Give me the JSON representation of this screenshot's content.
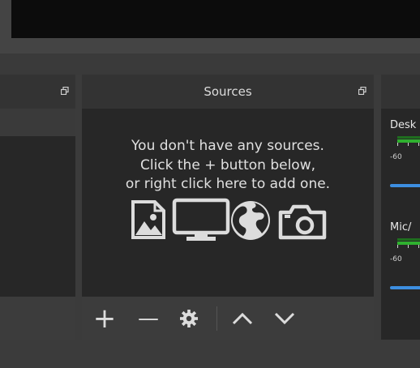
{
  "docks": {
    "sources": {
      "title": "Sources",
      "empty_message": [
        "You don't have any sources.",
        "Click the + button below,",
        "or right click here to add one."
      ],
      "icons": [
        "image-icon",
        "monitor-icon",
        "globe-icon",
        "camera-icon"
      ]
    },
    "mixer": {
      "channels": [
        {
          "label": "Desk",
          "db_label": "-60"
        },
        {
          "label": "Mic/",
          "db_label": "-60"
        }
      ]
    }
  },
  "toolbar": {
    "add_glyph": "+",
    "remove_glyph": "—"
  },
  "colors": {
    "meter_green": "#2fb02f",
    "slider_blue": "#3d8ee0",
    "panel_bg": "#272727",
    "header_bg": "#333333"
  }
}
